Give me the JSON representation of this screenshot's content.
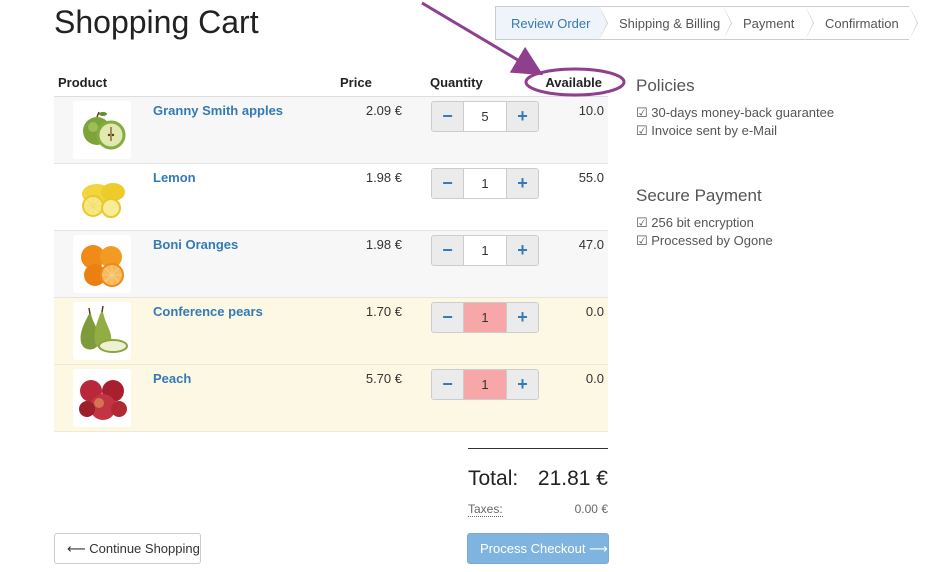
{
  "page": {
    "title": "Shopping Cart"
  },
  "wizard": {
    "steps": [
      {
        "label": "Review Order",
        "active": true
      },
      {
        "label": "Shipping & Billing"
      },
      {
        "label": "Payment"
      },
      {
        "label": "Confirmation"
      }
    ]
  },
  "table": {
    "headers": {
      "product": "Product",
      "price": "Price",
      "quantity": "Quantity",
      "available": "Available"
    },
    "rows": [
      {
        "name": "Granny Smith apples",
        "price": "2.09 €",
        "qty": "5",
        "available": "10.0",
        "image": "green-apple-image"
      },
      {
        "name": "Lemon",
        "price": "1.98 €",
        "qty": "1",
        "available": "55.0",
        "image": "lemon-image"
      },
      {
        "name": "Boni Oranges",
        "price": "1.98 €",
        "qty": "1",
        "available": "47.0",
        "image": "orange-image"
      },
      {
        "name": "Conference pears",
        "price": "1.70 €",
        "qty": "1",
        "available": "0.0",
        "image": "pear-image"
      },
      {
        "name": "Peach",
        "price": "5.70 €",
        "qty": "1",
        "available": "0.0",
        "image": "peach-image"
      }
    ],
    "minus": "−",
    "plus": "+"
  },
  "totals": {
    "total_label": "Total:",
    "total_value": "21.81 €",
    "tax_label": "Taxes:",
    "tax_value": "0.00 €"
  },
  "actions": {
    "continue": "⟵ Continue Shopping",
    "checkout": "Process Checkout ⟶"
  },
  "sidebar": {
    "policies_title": "Policies",
    "policies": [
      "☑ 30-days money-back guarantee",
      "☑ Invoice sent by e-Mail"
    ],
    "payment_title": "Secure Payment",
    "payment": [
      "☑ 256 bit encryption",
      "☑ Processed by Ogone"
    ]
  },
  "colors": {
    "link": "#337ab7",
    "warning_row": "#fcf8e3",
    "invalid_qty": "#f7a7a7",
    "annotation": "#8e3f8e"
  }
}
